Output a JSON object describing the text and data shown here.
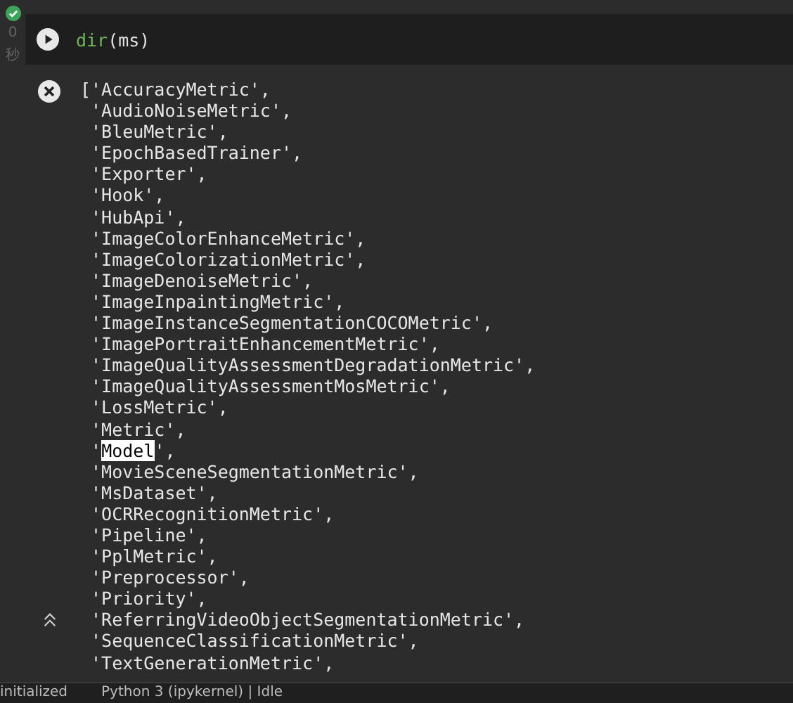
{
  "cell": {
    "succeeded": true,
    "exec_time": "0",
    "exec_unit": "秒",
    "code_fn": "dir",
    "code_args": "(ms)"
  },
  "output": {
    "lines": [
      {
        "text": "['AccuracyMetric',"
      },
      {
        "text": " 'AudioNoiseMetric',"
      },
      {
        "text": " 'BleuMetric',"
      },
      {
        "text": " 'EpochBasedTrainer',"
      },
      {
        "text": " 'Exporter',"
      },
      {
        "text": " 'Hook',"
      },
      {
        "text": " 'HubApi',"
      },
      {
        "text": " 'ImageColorEnhanceMetric',"
      },
      {
        "text": " 'ImageColorizationMetric',"
      },
      {
        "text": " 'ImageDenoiseMetric',"
      },
      {
        "text": " 'ImageInpaintingMetric',"
      },
      {
        "text": " 'ImageInstanceSegmentationCOCOMetric',"
      },
      {
        "text": " 'ImagePortraitEnhancementMetric',"
      },
      {
        "text": " 'ImageQualityAssessmentDegradationMetric',"
      },
      {
        "text": " 'ImageQualityAssessmentMosMetric',"
      },
      {
        "text": " 'LossMetric',"
      },
      {
        "text": " 'Metric',"
      },
      {
        "segments": [
          {
            "text": " '",
            "selected": false
          },
          {
            "text": "Model",
            "selected": true
          },
          {
            "text": "',",
            "selected": false
          }
        ]
      },
      {
        "text": " 'MovieSceneSegmentationMetric',"
      },
      {
        "text": " 'MsDataset',"
      },
      {
        "text": " 'OCRRecognitionMetric',"
      },
      {
        "text": " 'Pipeline',"
      },
      {
        "text": " 'PplMetric',"
      },
      {
        "text": " 'Preprocessor',"
      },
      {
        "text": " 'Priority',"
      },
      {
        "text": " 'ReferringVideoObjectSegmentationMetric',"
      },
      {
        "text": " 'SequenceClassificationMetric',"
      },
      {
        "text": " 'TextGenerationMetric',"
      }
    ]
  },
  "status_bar": {
    "left": "initialized",
    "kernel": "Python 3 (ipykernel) | Idle"
  }
}
